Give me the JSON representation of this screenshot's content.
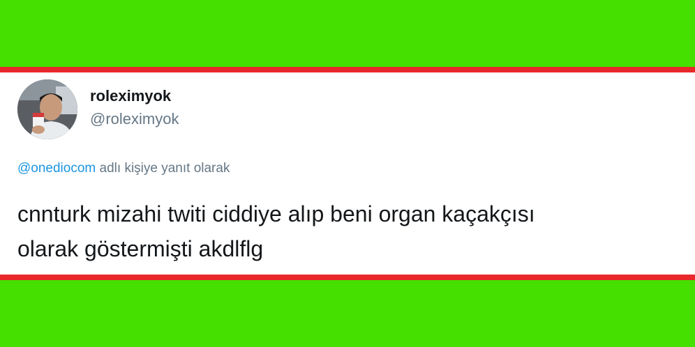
{
  "colors": {
    "background": "#45e000",
    "rule": "#e8282a",
    "card": "#ffffff",
    "mention": "#1b95e0",
    "secondary_text": "#657786",
    "primary_text": "#14171a"
  },
  "tweet": {
    "avatar_icon": "user-avatar-photo",
    "display_name": "roleximyok",
    "handle": "@roleximyok",
    "reply_mention": "@onediocom",
    "reply_suffix": " adlı kişiye yanıt olarak",
    "text_line1": "cnnturk mizahi twiti ciddiye alıp beni organ kaçakçısı",
    "text_line2": "olarak göstermişti akdlflg"
  }
}
